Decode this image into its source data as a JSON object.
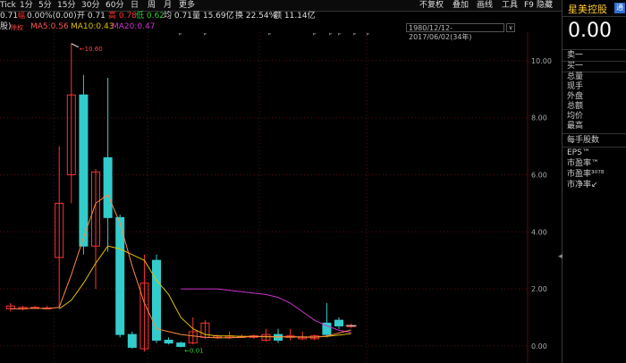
{
  "toolbar": {
    "periods": [
      "Tick",
      "1分",
      "5分",
      "15分",
      "30分",
      "60分",
      "日",
      "周",
      "月",
      "更多"
    ],
    "right": [
      "不复权",
      "叠加",
      "画线",
      "工具",
      "F9",
      "隐藏"
    ]
  },
  "quote": {
    "close": "0.71",
    "change_label": "幅",
    "change": "0.00%(0.00)",
    "open": "开 0.71",
    "high": "高 0.78",
    "low": "低 0.62",
    "avg": "均 0.71",
    "volume": "量 15.69亿",
    "turnover": "换 22.54%",
    "amount": "额 11.14亿"
  },
  "ma": {
    "prefix": "股)",
    "tag": "除权",
    "ma5": "MA5:0.56",
    "ma10": "MA10:0.43",
    "ma20": "MA20:0.47",
    "range": "1980/12/12-2017/06/02(34年)",
    "range_btn": "∨"
  },
  "colors": {
    "up": "#ff3333",
    "down": "#33cccc",
    "ma5": "#ffffff",
    "ma10": "#e0c000",
    "ma20": "#cc33cc",
    "grid": "#5a0f0f"
  },
  "chart_data": {
    "type": "candlestick",
    "y_ticks": [
      "10.00",
      "8.00",
      "6.00",
      "4.00",
      "2.00",
      "0.00"
    ],
    "ylim": [
      -0.6,
      11.0
    ],
    "max_label": "10.60",
    "min_label": "0.01",
    "candles": [
      {
        "o": 1.3,
        "c": 1.4,
        "h": 1.5,
        "l": 1.2
      },
      {
        "o": 1.3,
        "c": 1.35,
        "h": 1.4,
        "l": 1.25
      },
      {
        "o": 1.32,
        "c": 1.35,
        "h": 1.4,
        "l": 1.3
      },
      {
        "o": 1.3,
        "c": 1.33,
        "h": 1.4,
        "l": 1.28
      },
      {
        "o": 3.1,
        "c": 5.0,
        "h": 7.0,
        "l": 1.3
      },
      {
        "o": 6.0,
        "c": 8.8,
        "h": 10.6,
        "l": 5.0
      },
      {
        "o": 8.8,
        "c": 3.5,
        "h": 9.5,
        "l": 3.2
      },
      {
        "o": 3.5,
        "c": 6.1,
        "h": 6.2,
        "l": 2.0
      },
      {
        "o": 6.6,
        "c": 4.5,
        "h": 9.4,
        "l": 3.3
      },
      {
        "o": 4.5,
        "c": 0.4,
        "h": 4.6,
        "l": 0.3
      },
      {
        "o": 0.4,
        "c": -0.05,
        "h": 0.5,
        "l": -0.1
      },
      {
        "o": -0.1,
        "c": 2.2,
        "h": 3.2,
        "l": -0.2
      },
      {
        "o": 3.0,
        "c": 0.2,
        "h": 3.2,
        "l": 0.1
      },
      {
        "o": 0.2,
        "c": 0.1,
        "h": 0.3,
        "l": 0.05
      },
      {
        "o": 0.1,
        "c": -0.02,
        "h": 0.15,
        "l": -0.05
      },
      {
        "o": 0.1,
        "c": 0.5,
        "h": 1.0,
        "l": 0.05
      },
      {
        "o": 0.3,
        "c": 0.8,
        "h": 0.9,
        "l": 0.25
      },
      {
        "o": 0.3,
        "c": 0.35,
        "h": 0.4,
        "l": 0.25
      },
      {
        "o": 0.3,
        "c": 0.35,
        "h": 0.5,
        "l": 0.25
      },
      {
        "o": 0.3,
        "c": 0.33,
        "h": 0.4,
        "l": 0.28
      },
      {
        "o": 0.3,
        "c": 0.35,
        "h": 0.4,
        "l": 0.25
      },
      {
        "o": 0.2,
        "c": 0.4,
        "h": 0.6,
        "l": 0.15
      },
      {
        "o": 0.4,
        "c": 0.2,
        "h": 0.6,
        "l": 0.1
      },
      {
        "o": 0.3,
        "c": 0.35,
        "h": 0.6,
        "l": 0.2
      },
      {
        "o": 0.25,
        "c": 0.3,
        "h": 0.5,
        "l": 0.2
      },
      {
        "o": 0.25,
        "c": 0.35,
        "h": 0.4,
        "l": 0.2
      },
      {
        "o": 0.8,
        "c": 0.4,
        "h": 1.5,
        "l": 0.3
      },
      {
        "o": 0.9,
        "c": 0.7,
        "h": 1.0,
        "l": 0.6
      },
      {
        "o": 0.7,
        "c": 0.71,
        "h": 0.78,
        "l": 0.62
      }
    ],
    "ma5": [
      1.3,
      1.3,
      1.32,
      1.31,
      1.35,
      2.5,
      3.8,
      5.0,
      5.3,
      4.3,
      2.8,
      1.5,
      0.6,
      0.5,
      0.4,
      0.35,
      0.3,
      0.28,
      0.28,
      0.3,
      0.33,
      0.33,
      0.32,
      0.32,
      0.31,
      0.3,
      0.35,
      0.45,
      0.56
    ],
    "ma10": [
      null,
      null,
      null,
      null,
      1.3,
      1.6,
      2.2,
      2.9,
      3.5,
      3.4,
      3.2,
      3.0,
      2.3,
      1.8,
      1.0,
      0.6,
      0.4,
      0.35,
      0.35,
      0.33,
      0.33,
      0.32,
      0.32,
      0.32,
      0.32,
      0.31,
      0.33,
      0.38,
      0.43
    ],
    "ma20": [
      null,
      null,
      null,
      null,
      null,
      null,
      null,
      null,
      null,
      null,
      null,
      null,
      null,
      null,
      2.0,
      2.0,
      2.0,
      2.0,
      1.95,
      1.9,
      1.85,
      1.8,
      1.7,
      1.5,
      1.2,
      0.9,
      0.7,
      0.55,
      0.47
    ],
    "markers": [
      "ᴾ",
      "ᴾ",
      "ᴾ",
      "ᴾ",
      "ᴾ",
      "ᴾ",
      "ᴾ",
      "ᴾ"
    ]
  },
  "panel": {
    "title": "星美控股",
    "badge": "通",
    "price": "0.00",
    "rows1": [
      "卖一",
      "买一"
    ],
    "rows2": [
      "总量",
      "现手",
      "外盘",
      "总额",
      "均价",
      "最高"
    ],
    "rows3": [
      "每手股数"
    ],
    "rows4": [
      "EPS™",
      "市盈率™",
      "市盈率³⁰⁷⁸",
      "市净率↙"
    ]
  }
}
